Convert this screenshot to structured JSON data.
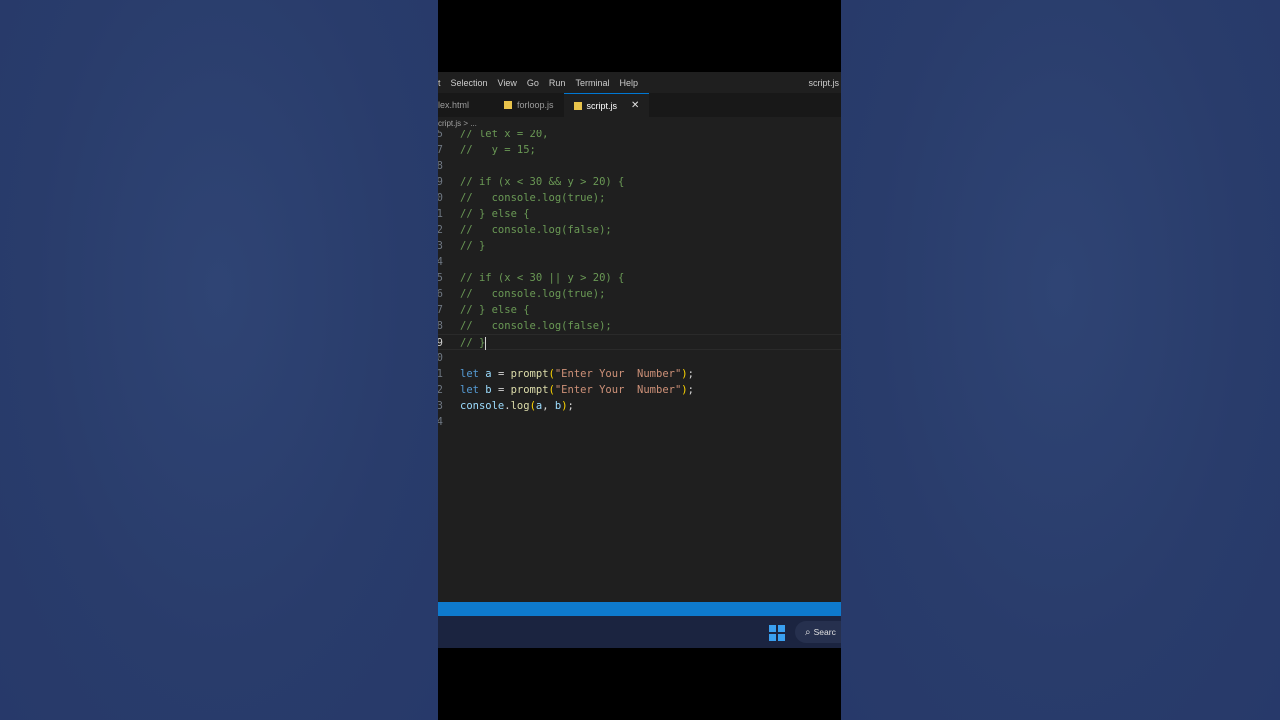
{
  "menubar": {
    "items": [
      "t",
      "Selection",
      "View",
      "Go",
      "Run",
      "Terminal",
      "Help"
    ],
    "window_title": "script.js"
  },
  "tabs": [
    {
      "label": "lex.html",
      "active": false
    },
    {
      "label": "forloop.js",
      "active": false
    },
    {
      "label": "script.js",
      "active": true,
      "close": "✕"
    }
  ],
  "breadcrumb": "cript.js > ...",
  "editor": {
    "current_line": "9",
    "lines": [
      {
        "num": "5",
        "text": "// let x = 20,"
      },
      {
        "num": "7",
        "text": "//   y = 15;"
      },
      {
        "num": "8",
        "text": ""
      },
      {
        "num": "9",
        "text": "// if (x < 30 && y > 20) {"
      },
      {
        "num": "0",
        "text": "//   console.log(true);"
      },
      {
        "num": "1",
        "text": "// } else {"
      },
      {
        "num": "2",
        "text": "//   console.log(false);"
      },
      {
        "num": "3",
        "text": "// }"
      },
      {
        "num": "4",
        "text": ""
      },
      {
        "num": "5",
        "text": "// if (x < 30 || y > 20) {"
      },
      {
        "num": "6",
        "text": "//   console.log(true);"
      },
      {
        "num": "7",
        "text": "// } else {"
      },
      {
        "num": "8",
        "text": "//   console.log(false);"
      },
      {
        "num": "9",
        "text": "// }"
      },
      {
        "num": "0",
        "text": ""
      },
      {
        "num": "1",
        "text": "let a = prompt(\"Enter Your  Number\");"
      },
      {
        "num": "2",
        "text": "let b = prompt(\"Enter Your  Number\");"
      },
      {
        "num": "3",
        "text": "console.log(a, b);"
      },
      {
        "num": "4",
        "text": ""
      }
    ]
  },
  "taskbar": {
    "search_label": "Searc",
    "search_icon": "search-icon",
    "start_icon": "windows-start-icon"
  },
  "colors": {
    "status_bar": "#0e7acd",
    "comment": "#6a9955",
    "keyword": "#569cd6",
    "string": "#ce9178"
  }
}
